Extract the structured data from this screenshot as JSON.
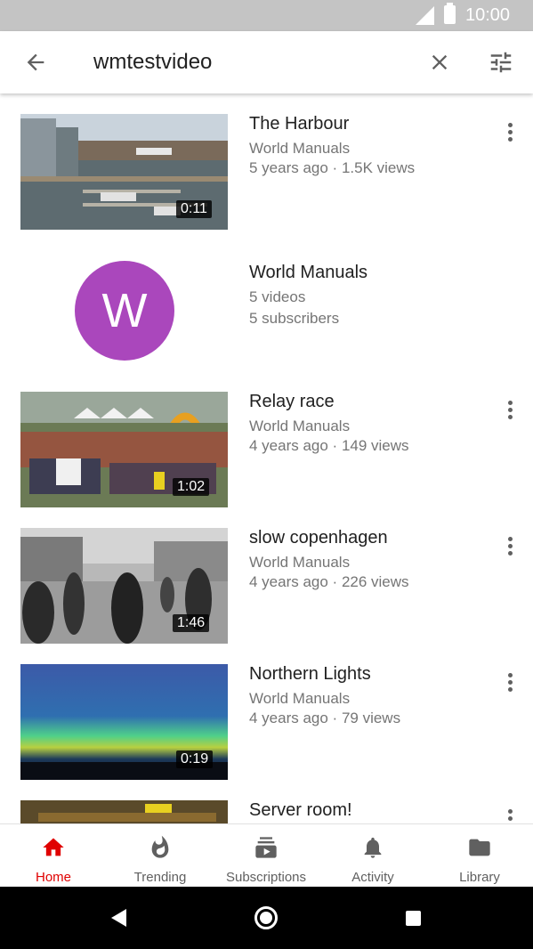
{
  "status_bar": {
    "time": "10:00"
  },
  "search": {
    "query": "wmtestvideo"
  },
  "results": {
    "harbour": {
      "title": "The Harbour",
      "channel": "World Manuals",
      "info": "5 years ago · 1.5K views",
      "duration": "0:11"
    },
    "channel": {
      "initial": "W",
      "name": "World Manuals",
      "videos": "5 videos",
      "subscribers": "5 subscribers",
      "avatar_color": "#aa47bc"
    },
    "relay": {
      "title": "Relay race",
      "channel": "World Manuals",
      "info": "4 years ago · 149 views",
      "duration": "1:02"
    },
    "copenhagen": {
      "title": "slow copenhagen",
      "channel": "World Manuals",
      "info": "4 years ago · 226 views",
      "duration": "1:46"
    },
    "northern": {
      "title": "Northern Lights",
      "channel": "World Manuals",
      "info": "4 years ago · 79 views",
      "duration": "0:19"
    },
    "server": {
      "title": "Server room!"
    }
  },
  "bottom_nav": {
    "home": "Home",
    "trending": "Trending",
    "subscriptions": "Subscriptions",
    "activity": "Activity",
    "library": "Library"
  },
  "colors": {
    "accent": "#e00000",
    "text_secondary": "#757575"
  }
}
